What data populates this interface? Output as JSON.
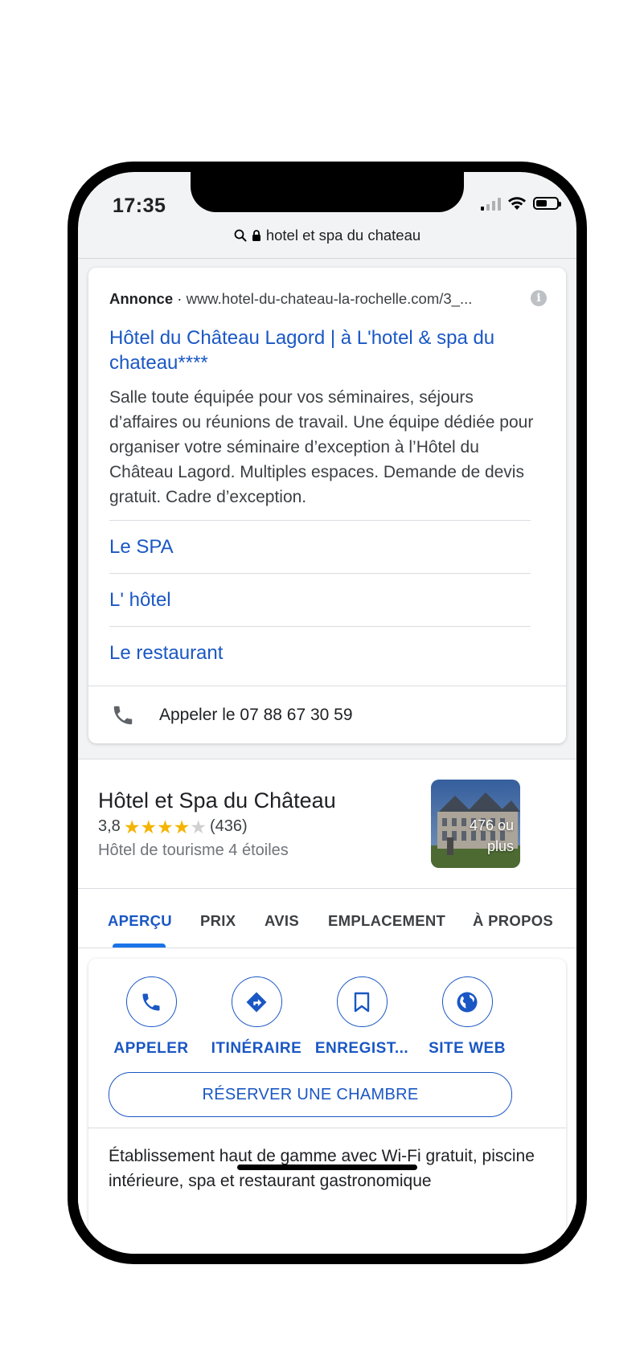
{
  "status": {
    "time": "17:35"
  },
  "urlbar": {
    "query": "hotel et spa du chateau"
  },
  "ad": {
    "label": "Annonce",
    "separator": "·",
    "url": "www.hotel-du-chateau-la-rochelle.com/3_...",
    "info": "i",
    "title": "Hôtel du Château Lagord | à L'hotel & spa du chateau****",
    "description": "Salle toute équipée pour vos séminaires, séjours d’affaires ou réunions de travail. Une équipe dédiée pour organiser votre séminaire d’exception à l’Hôtel du Château Lagord. Multiples espaces. Demande de devis gratuit. Cadre d’exception.",
    "sitelinks": [
      "Le SPA",
      "L' hôtel",
      "Le restaurant"
    ],
    "call": "Appeler le 07 88 67 30 59"
  },
  "knowledge_panel": {
    "name": "Hôtel et Spa du Château",
    "rating": "3,8",
    "rating_value": 3.8,
    "reviews": "(436)",
    "type": "Hôtel de tourisme 4 étoiles",
    "photo_count": "476 ou plus",
    "tabs": [
      "APERÇU",
      "PRIX",
      "AVIS",
      "EMPLACEMENT",
      "À PROPOS"
    ],
    "actions": [
      {
        "label": "APPELER",
        "icon": "phone-icon"
      },
      {
        "label": "ITINÉRAIRE",
        "icon": "directions-icon"
      },
      {
        "label": "ENREGIST...",
        "icon": "bookmark-icon"
      },
      {
        "label": "SITE WEB",
        "icon": "globe-icon"
      }
    ],
    "reserve": "RÉSERVER UNE CHAMBRE",
    "description": "Établissement haut de gamme avec Wi-Fi gratuit, piscine intérieure, spa et restaurant gastronomique"
  },
  "colors": {
    "link": "#1a57c4",
    "accent": "#1a73e8",
    "star": "#f4b400"
  }
}
